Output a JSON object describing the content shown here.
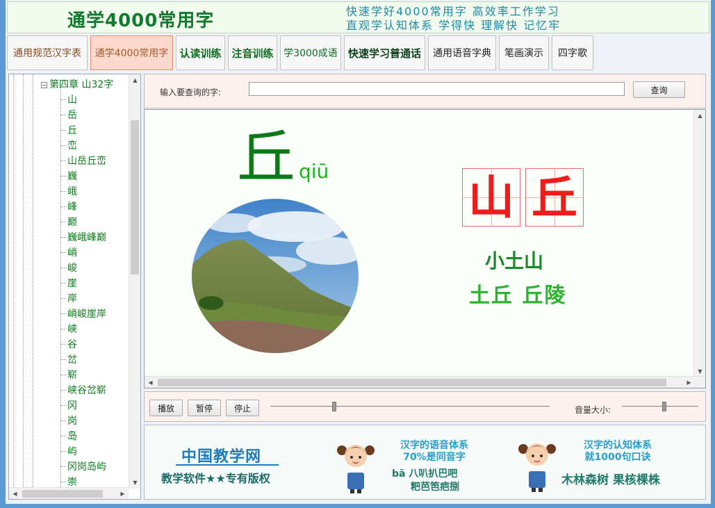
{
  "banner": {
    "title": "通学4000常用字",
    "slogan_line1": "快速学好4000常用字  高效率工作学习",
    "slogan_line2": "直观学认知体系  学得快  理解快  记忆牢"
  },
  "tabs": [
    {
      "label": "通用规范汉字表"
    },
    {
      "label": "通学4000常用字"
    },
    {
      "label": "认读训练"
    },
    {
      "label": "注音训练"
    },
    {
      "label": "学3000成语"
    },
    {
      "label": "快速学习普通话"
    },
    {
      "label": "通用语音字典"
    },
    {
      "label": "笔画演示"
    },
    {
      "label": "四字歌"
    }
  ],
  "tree": {
    "chapter": "第四章 山32字",
    "expand_symbol": "−",
    "items": [
      "山",
      "岳",
      "丘",
      "峦",
      "山岳丘峦",
      "巍",
      "峨",
      "峰",
      "巅",
      "巍峨峰巅",
      "峭",
      "峻",
      "崖",
      "岸",
      "峭峻崖岸",
      "峡",
      "谷",
      "岔",
      "崭",
      "峡谷岔崭",
      "冈",
      "岗",
      "岛",
      "屿",
      "冈岗岛屿",
      "崇"
    ]
  },
  "search": {
    "label": "输入要查询的字:",
    "value": "",
    "button": "查询"
  },
  "character": {
    "char": "丘",
    "pinyin": "qiū",
    "grid_chars": [
      "山",
      "丘"
    ],
    "meaning": "小土山",
    "words": "土丘  丘陵"
  },
  "player": {
    "play": "播放",
    "pause": "暂停",
    "stop": "停止",
    "volume_label": "音量大小:",
    "progress": 0.23,
    "volume": 0.55
  },
  "footer": {
    "brand": "中国教学网",
    "copyright": "教学软件★★专有版权",
    "ad1_line1": "汉字的语音体系",
    "ad1_line2": "70%是同音字",
    "ad1_line3": "bā 八叭扒巴吧",
    "ad1_line4": "粑芭笆疤捌",
    "ad2_line1": "汉字的认知体系",
    "ad2_line2": "就1000句口诀",
    "ad2_line3": "木林森树  果核棵株"
  }
}
